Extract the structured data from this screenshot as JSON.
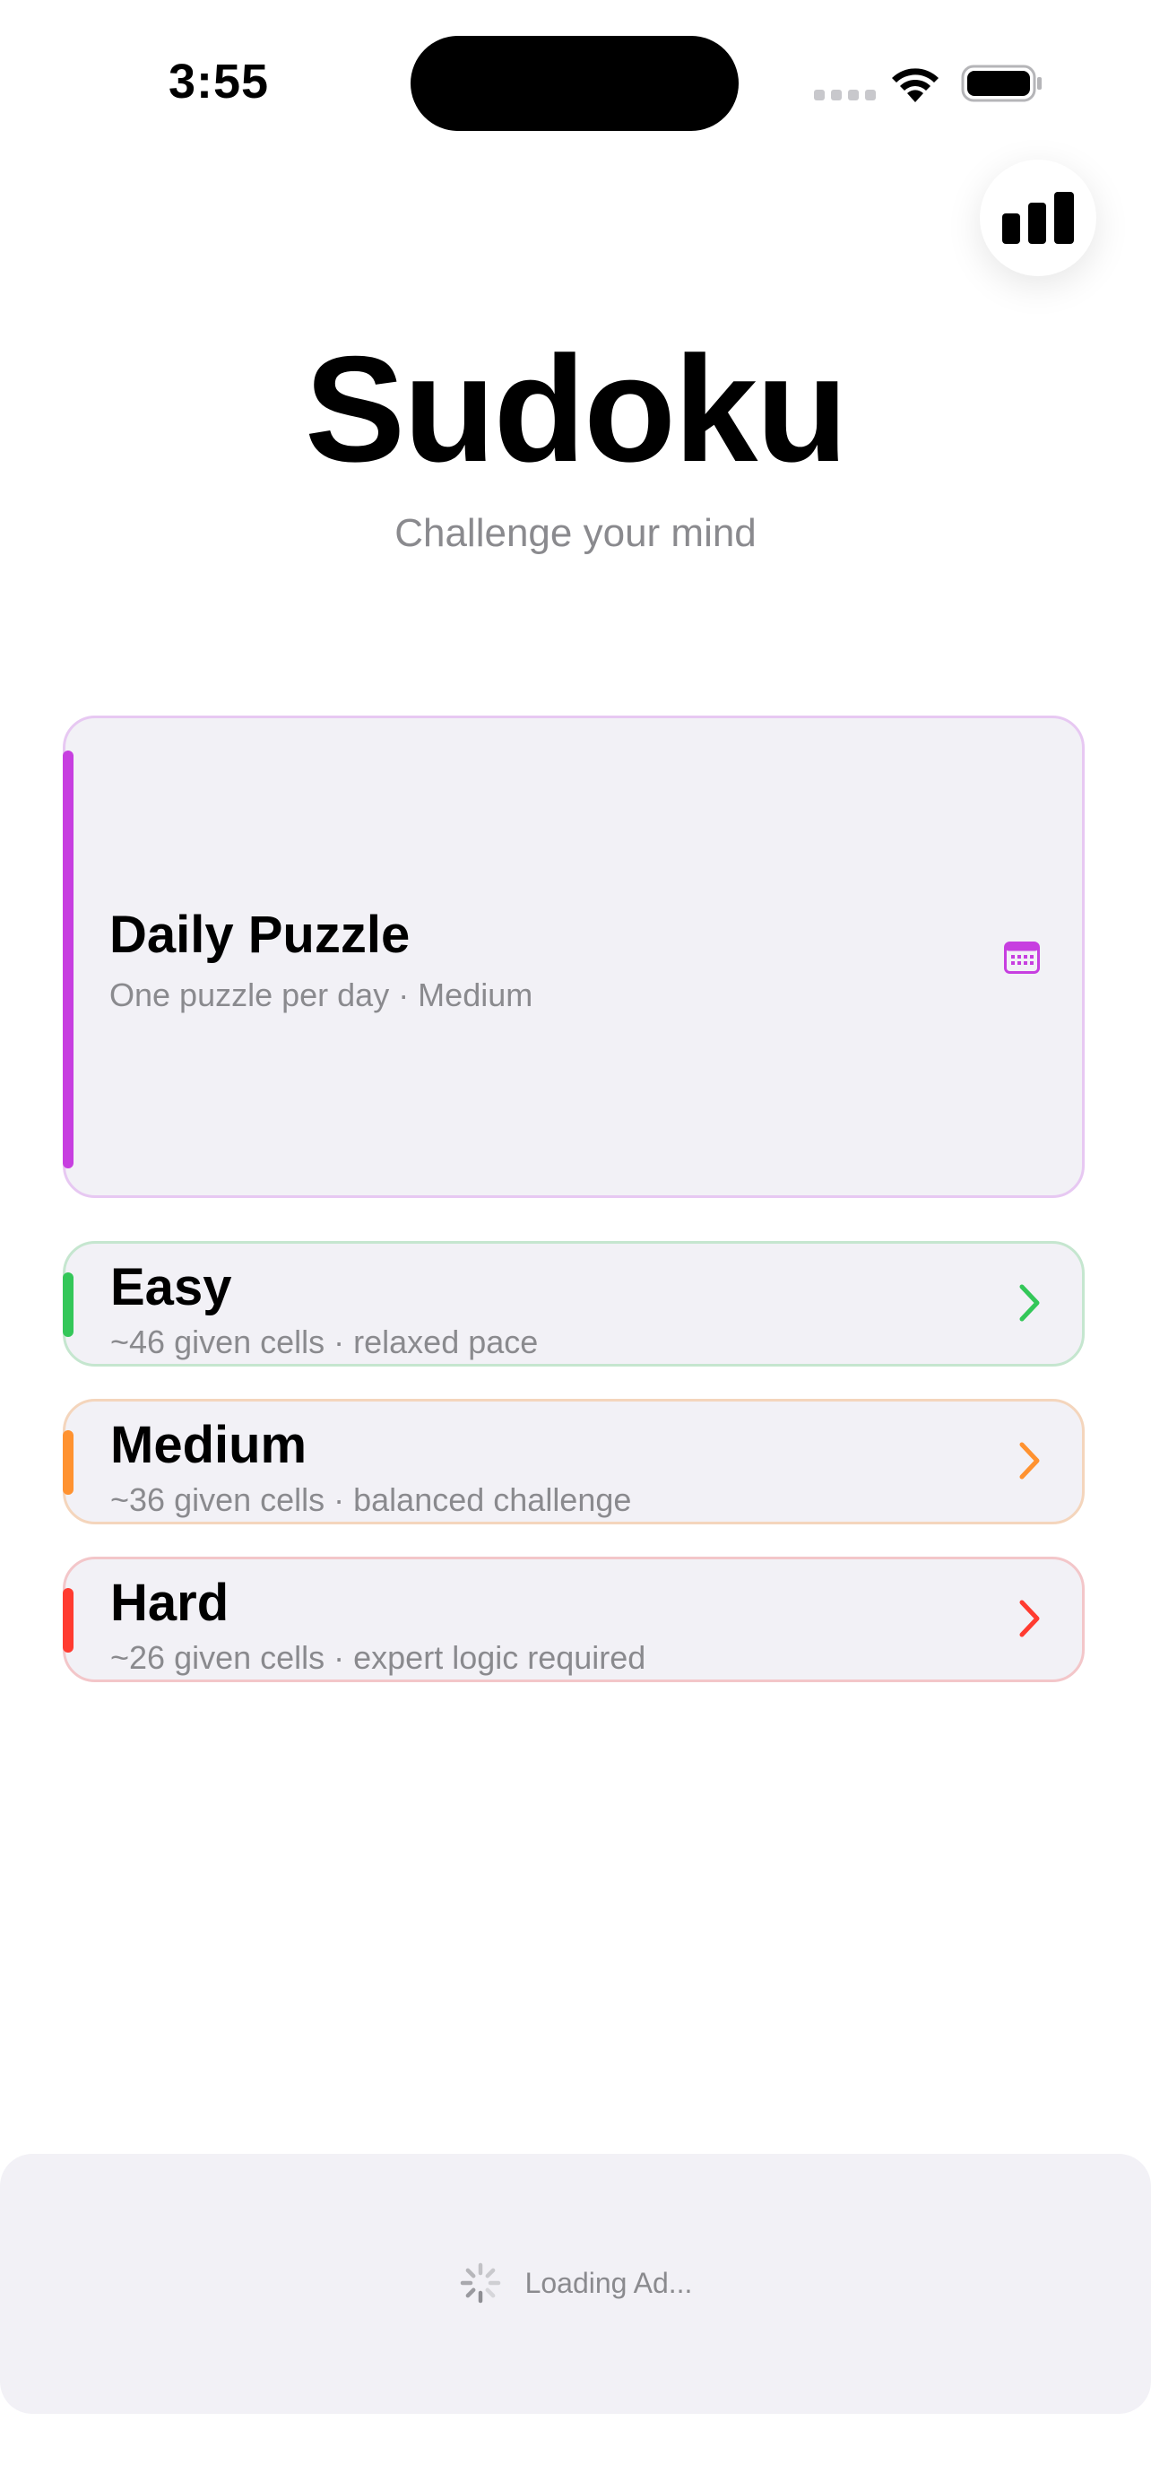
{
  "status_bar": {
    "time": "3:55"
  },
  "header": {
    "title": "Sudoku",
    "subtitle": "Challenge your mind"
  },
  "stats_button": {
    "icon": "bar-chart-icon"
  },
  "modes": {
    "daily": {
      "title": "Daily Puzzle",
      "description": "One puzzle per day · Medium",
      "accent_color": "#c73fe0",
      "icon": "calendar-icon"
    },
    "easy": {
      "title": "Easy",
      "description": "~46 given cells · relaxed pace",
      "accent_color": "#34c759",
      "icon": "chevron-right-icon"
    },
    "medium": {
      "title": "Medium",
      "description": "~36 given cells · balanced challenge",
      "accent_color": "#ff9230",
      "icon": "chevron-right-icon"
    },
    "hard": {
      "title": "Hard",
      "description": "~26 given cells · expert logic required",
      "accent_color": "#ff3b30",
      "icon": "chevron-right-icon"
    }
  },
  "ad": {
    "loading_text": "Loading Ad..."
  }
}
